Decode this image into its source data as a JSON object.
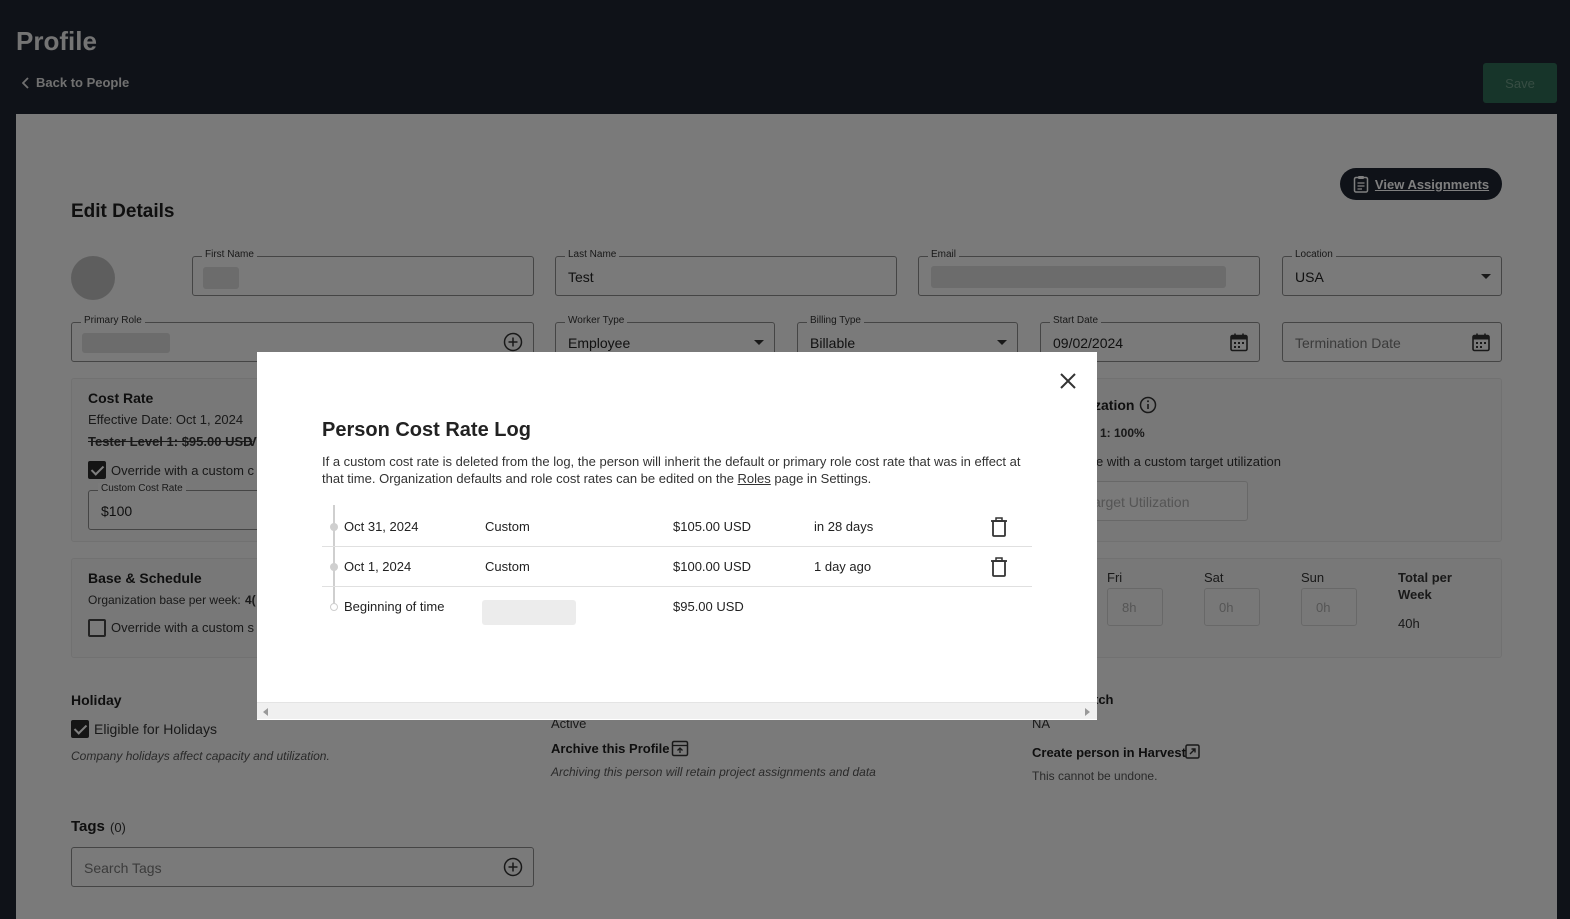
{
  "header": {
    "title": "Profile",
    "back_label": "Back to People",
    "save_label": "Save"
  },
  "panel": {
    "view_assignments": "View Assignments",
    "edit_title": "Edit Details",
    "first_name": {
      "label": "First Name",
      "value": ""
    },
    "last_name": {
      "label": "Last Name",
      "value": "Test"
    },
    "email": {
      "label": "Email",
      "value": ""
    },
    "location": {
      "label": "Location",
      "value": "USA"
    },
    "primary_role": {
      "label": "Primary Role",
      "value": ""
    },
    "worker_type": {
      "label": "Worker Type",
      "value": "Employee"
    },
    "billing_type": {
      "label": "Billing Type",
      "value": "Billable"
    },
    "start_date": {
      "label": "Start Date",
      "value": "09/02/2024"
    },
    "termination_date": {
      "placeholder": "Termination Date"
    },
    "cost_rate": {
      "title": "Cost Rate",
      "effective": "Effective Date:  Oct 1, 2024",
      "struck": "Tester Level 1: $95.00 USD",
      "trail": "V",
      "override_label": "Override with a custom c",
      "override_checked": true,
      "custom_label": "Custom Cost Rate",
      "custom_value": "$100"
    },
    "utilization": {
      "title_partial": "zation",
      "value_partial": "1: 100%",
      "override_partial": "e with a custom target utilization",
      "target_placeholder": "arget Utilization"
    },
    "base_schedule": {
      "title": "Base & Schedule",
      "org_base": "Organization base per week:",
      "org_base_trail": "4(",
      "override_label": "Override with a custom s",
      "days": [
        {
          "name": "Fri",
          "value": "8h"
        },
        {
          "name": "Sat",
          "value": "0h"
        },
        {
          "name": "Sun",
          "value": "0h"
        }
      ],
      "total_label_1": "Total per",
      "total_label_2": "Week",
      "total_value": "40h"
    },
    "holiday": {
      "title": "Holiday",
      "eligible_label": "Eligible for Holidays",
      "note": "Company holidays affect capacity and utilization."
    },
    "status": {
      "active": "Active",
      "archive_label": "Archive this Profile",
      "archive_note": "Archiving this person will retain project assignments and data"
    },
    "harvest": {
      "title_partial": "tch",
      "value": "NA",
      "create_label": "Create person in Harvest",
      "note": "This cannot be undone."
    },
    "tags": {
      "title": "Tags",
      "count": "(0)",
      "search_placeholder": "Search Tags"
    }
  },
  "modal": {
    "title": "Person Cost Rate Log",
    "desc_before": "If a custom cost rate is deleted from the log, the person will inherit the default or primary role cost rate that was in effect at that time. Organization defaults and role cost rates can be edited on the ",
    "desc_link": "Roles",
    "desc_after": " page in Settings.",
    "rows": [
      {
        "date": "Oct 31, 2024",
        "type": "Custom",
        "amount": "$105.00 USD",
        "relative": "in 28 days"
      },
      {
        "date": "Oct 1, 2024",
        "type": "Custom",
        "amount": "$100.00 USD",
        "relative": "1 day ago"
      },
      {
        "date": "Beginning of time",
        "type": "",
        "amount": "$95.00 USD",
        "relative": ""
      }
    ]
  }
}
